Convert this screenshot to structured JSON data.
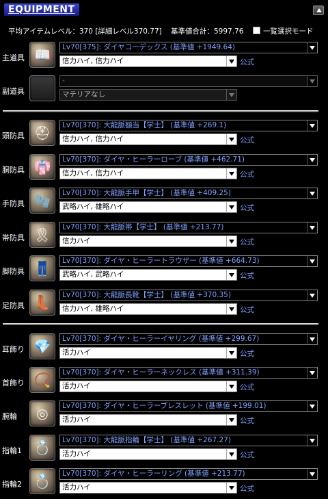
{
  "header": {
    "title": "EQUIPMENT"
  },
  "summary": {
    "avg_item_level": "平均アイテムレベル：370 [詳細レベル370.77]",
    "base_total": "基準値合計：5997.76",
    "list_mode_label": "一覧選択モード"
  },
  "official_label": "公式",
  "slots": [
    {
      "label": "主道具",
      "icon": "codex-weapon-icon",
      "item": "Lv70[375]: ダイヤコーデックス (基準値 +1949.64)",
      "materia": "信力ハイ, 信力ハイ",
      "disabled": false
    },
    {
      "label": "副道具",
      "icon": "empty-slot-icon",
      "item": "-",
      "materia": "マテリアなし",
      "disabled": true
    },
    {
      "label": "頭防具",
      "icon": "head-armor-icon",
      "item": "Lv70[370]: 大龍脈額当【学士】 (基準値 +269.1)",
      "materia": "信力ハイ, 信力ハイ",
      "disabled": false
    },
    {
      "label": "胴防具",
      "icon": "body-armor-icon",
      "item": "Lv70[370]: ダイヤ・ヒーラーローブ (基準値 +462.71)",
      "materia": "信力ハイ, 信力ハイ",
      "disabled": false
    },
    {
      "label": "手防具",
      "icon": "hand-armor-icon",
      "item": "Lv70[370]: 大龍脈手甲【学士】 (基準値 +409.25)",
      "materia": "武略ハイ, 雄略ハイ",
      "disabled": false
    },
    {
      "label": "帯防具",
      "icon": "waist-armor-icon",
      "item": "Lv70[370]: 大龍脈帯【学士】 (基準値 +213.77)",
      "materia": "信力ハイ",
      "disabled": false
    },
    {
      "label": "脚防具",
      "icon": "leg-armor-icon",
      "item": "Lv70[370]: ダイヤ・ヒーラートラウザー (基準値 +664.73)",
      "materia": "武略ハイ, 武略ハイ",
      "disabled": false
    },
    {
      "label": "足防具",
      "icon": "feet-armor-icon",
      "item": "Lv70[370]: 大龍脈長靴【学士】 (基準値 +370.35)",
      "materia": "信力ハイ, 雄略ハイ",
      "disabled": false
    },
    {
      "label": "耳飾り",
      "icon": "earring-icon",
      "item": "Lv70[370]: ダイヤ・ヒーラーイヤリング (基準値 +299.67)",
      "materia": "活力ハイ",
      "disabled": false
    },
    {
      "label": "首飾り",
      "icon": "necklace-icon",
      "item": "Lv70[370]: ダイヤ・ヒーラーネックレス (基準値 +311.39)",
      "materia": "活力ハイ",
      "disabled": false
    },
    {
      "label": "腕輪",
      "icon": "bracelet-icon",
      "item": "Lv70[370]: ダイヤ・ヒーラーブレスレット (基準値 +199.01)",
      "materia": "活力ハイ",
      "disabled": false
    },
    {
      "label": "指輪1",
      "icon": "ring-icon",
      "item": "Lv70[370]: 大龍脈指輪【学士】 (基準値 +267.27)",
      "materia": "活力ハイ",
      "disabled": false
    },
    {
      "label": "指輪2",
      "icon": "ring-icon",
      "item": "Lv70[370]: ダイヤ・ヒーラーリング (基準値 +213.77)",
      "materia": "活力ハイ",
      "disabled": false
    }
  ]
}
